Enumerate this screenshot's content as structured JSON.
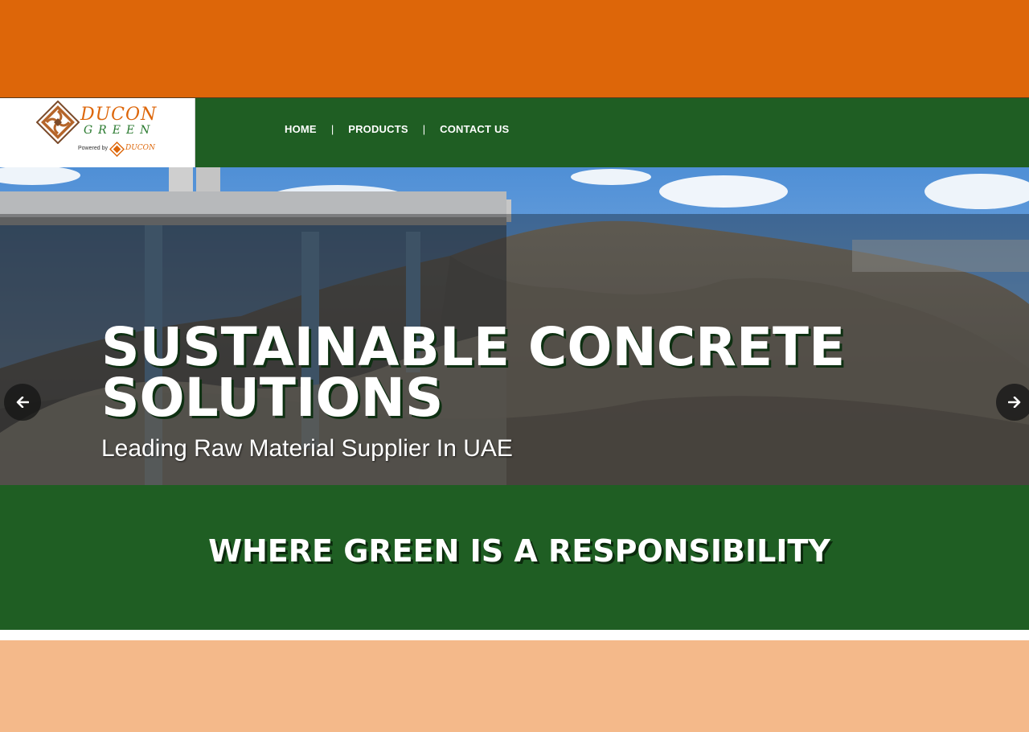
{
  "brand": {
    "name_line1": "DUCON",
    "name_line2": "GREEN",
    "powered_by": "Powered by",
    "parent_name": "DUCON"
  },
  "nav": {
    "items": [
      "HOME",
      "PRODUCTS",
      "CONTACT US"
    ],
    "separator": "|"
  },
  "hero": {
    "title_line1": "SUSTAINABLE CONCRETE",
    "title_line2": "SOLUTIONS",
    "subtitle": "Leading Raw Material Supplier In UAE",
    "prev_icon": "arrow-left-icon",
    "next_icon": "arrow-right-icon"
  },
  "tagline": "WHERE GREEN IS A RESPONSIBILITY",
  "colors": {
    "orange_band": "#dd6609",
    "brand_green": "#1f5e23",
    "peach_band": "#f4b98a",
    "text_white": "#ffffff"
  }
}
